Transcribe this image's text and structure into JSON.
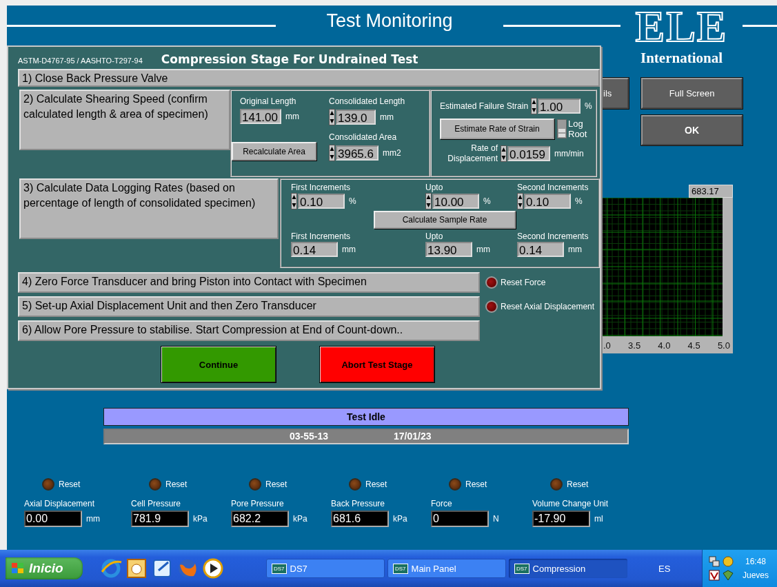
{
  "window": {
    "title": "Test Monitoring"
  },
  "logo": {
    "mark": "ELE",
    "subtitle": "International"
  },
  "side_buttons": [
    {
      "label": "ils"
    },
    {
      "label": "Full Screen"
    },
    {
      "label": "OK"
    }
  ],
  "chart": {
    "readout": "683.17",
    "x_ticks": [
      ".0",
      "3.5",
      "4.0",
      "4.5",
      "5.0"
    ]
  },
  "status": {
    "state": "Test Idle",
    "time": "03-55-13",
    "date": "17/01/23"
  },
  "channels": [
    {
      "reset": "Reset",
      "label": "Axial Displacement",
      "value": "0.00",
      "unit": "mm"
    },
    {
      "reset": "Reset",
      "label": "Cell Pressure",
      "value": "781.9",
      "unit": "kPa"
    },
    {
      "reset": "Reset",
      "label": "Pore Pressure",
      "value": "682.2",
      "unit": "kPa"
    },
    {
      "reset": "Reset",
      "label": "Back Pressure",
      "value": "681.6",
      "unit": "kPa"
    },
    {
      "reset": "Reset",
      "label": "Force",
      "value": "0",
      "unit": "N"
    },
    {
      "reset": "Reset",
      "label": "Volume Change Unit",
      "value": "-17.90",
      "unit": "ml"
    }
  ],
  "dialog": {
    "standard": "ASTM-D4767-95 / AASHTO-T297-94",
    "title": "Compression Stage For Undrained Test",
    "steps": [
      "1) Close Back Pressure Valve",
      "2) Calculate Shearing Speed (confirm calculated length & area of specimen)",
      "3) Calculate Data Logging Rates  (based on percentage of length of consolidated specimen)",
      "4) Zero Force Transducer and bring Piston into Contact with Specimen",
      "5) Set-up Axial Displacement Unit and then Zero Transducer",
      "6) Allow Pore Pressure to stabilise. Start Compression at End of Count-down.."
    ],
    "specimen": {
      "original_length": {
        "label": "Original Length",
        "value": "141.00",
        "unit": "mm"
      },
      "consolidated_length": {
        "label": "Consolidated Length",
        "value": "139.0",
        "unit": "mm"
      },
      "recalculate": "Recalculate Area",
      "consolidated_area": {
        "label": "Consolidated Area",
        "value": "3965.6",
        "unit": "mm2"
      }
    },
    "strain": {
      "failure": {
        "label": "Estimated Failure Strain",
        "value": "1.00",
        "unit": "%"
      },
      "estimate": "Estimate Rate of Strain",
      "switch_labels": [
        "Log",
        "Root"
      ],
      "log_selected": false,
      "rate": {
        "label": "Rate of Displacement",
        "value": "0.0159",
        "unit": "mm/min"
      }
    },
    "logging": {
      "percent": [
        {
          "label": "First Increments",
          "value": "0.10",
          "unit": "%"
        },
        {
          "label": "Upto",
          "value": "10.00",
          "unit": "%"
        },
        {
          "label": "Second Increments",
          "value": "0.10",
          "unit": "%"
        }
      ],
      "calculate": "Calculate Sample Rate",
      "length": [
        {
          "label": "First Increments",
          "value": "0.14",
          "unit": "mm"
        },
        {
          "label": "Upto",
          "value": "13.90",
          "unit": "mm"
        },
        {
          "label": "Second Increments",
          "value": "0.14",
          "unit": "mm"
        }
      ]
    },
    "resets": [
      "Reset Force",
      "Reset Axial Displacement"
    ],
    "buttons": [
      {
        "label": "Continue",
        "color": "#339900"
      },
      {
        "label": "Abort Test Stage",
        "color": "#ff0000"
      }
    ]
  },
  "taskbar": {
    "start": "Inicio",
    "tasks": [
      {
        "badge": "DS7",
        "label": "DS7",
        "selected": false
      },
      {
        "badge": "DS7",
        "label": "Main Panel",
        "selected": false
      },
      {
        "badge": "DS7",
        "label": "Compression",
        "selected": true
      }
    ],
    "language": "ES",
    "time": "16:48",
    "day": "Jueves"
  }
}
